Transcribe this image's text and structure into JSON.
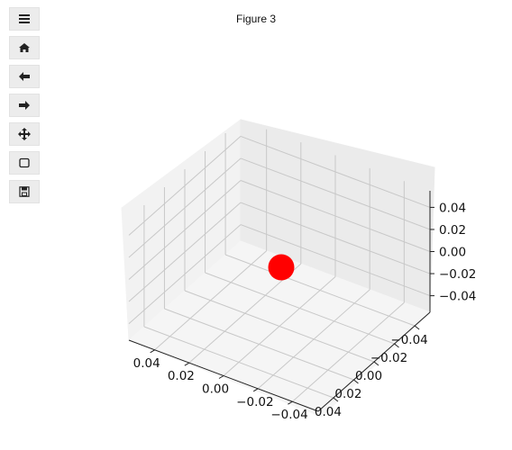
{
  "figure": {
    "title": "Figure 3"
  },
  "toolbar": {
    "buttons": [
      {
        "name": "menu",
        "icon": "hamburger-menu-icon"
      },
      {
        "name": "home",
        "icon": "home-icon"
      },
      {
        "name": "back",
        "icon": "arrow-left-icon"
      },
      {
        "name": "forward",
        "icon": "arrow-right-icon"
      },
      {
        "name": "pan",
        "icon": "move-icon"
      },
      {
        "name": "zoom",
        "icon": "zoom-rect-icon"
      },
      {
        "name": "save",
        "icon": "save-icon"
      }
    ]
  },
  "chart_data": {
    "type": "scatter",
    "projection": "3d",
    "grid": true,
    "title": "",
    "xlabel": "",
    "ylabel": "",
    "zlabel": "",
    "xlim": [
      -0.055,
      0.055
    ],
    "ylim": [
      -0.055,
      0.055
    ],
    "zlim": [
      -0.055,
      0.055
    ],
    "x_ticks": [
      "−0.04",
      "−0.02",
      "0.00",
      "0.02",
      "0.04"
    ],
    "y_ticks": [
      "−0.04",
      "−0.02",
      "0.00",
      "0.02",
      "0.04"
    ],
    "z_ticks": [
      "−0.04",
      "−0.02",
      "0.00",
      "0.02",
      "0.04"
    ],
    "points": [
      {
        "x": 0,
        "y": 0,
        "z": 0
      }
    ],
    "marker_color": "#ff0000"
  }
}
